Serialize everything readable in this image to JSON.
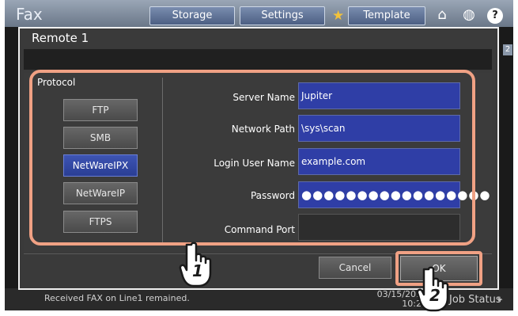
{
  "background_screen": {
    "title": "Fax",
    "tabs": [
      "Storage",
      "Settings",
      "Template"
    ],
    "status_message": "Received FAX on Line1 remained.",
    "datetime": [
      "03/15/2016",
      "10:28"
    ],
    "job_status_label": "Job Status",
    "right_indicator": "2"
  },
  "dialog": {
    "title": "Remote 1",
    "protocol": {
      "label": "Protocol",
      "options": [
        "FTP",
        "SMB",
        "NetWareIPX",
        "NetWareIP",
        "FTPS"
      ],
      "selected": "NetWareIPX"
    },
    "fields": [
      {
        "label": "Server Name",
        "value": "Jupiter"
      },
      {
        "label": "Network Path",
        "value": "\\sys\\scan"
      },
      {
        "label": "Login User Name",
        "value": "example.com"
      },
      {
        "label": "Password",
        "value": "●●●●●●●●●●●●●●●●●"
      },
      {
        "label": "Command Port",
        "value": ""
      }
    ],
    "cancel_label": "Cancel",
    "ok_label": "OK"
  },
  "annotations": {
    "step_1": "1",
    "step_2": "2",
    "highlight_color": "#f0a184"
  },
  "colors": {
    "selected_option": "#2f3ea6",
    "dialog_background": "#3a3a3a"
  }
}
